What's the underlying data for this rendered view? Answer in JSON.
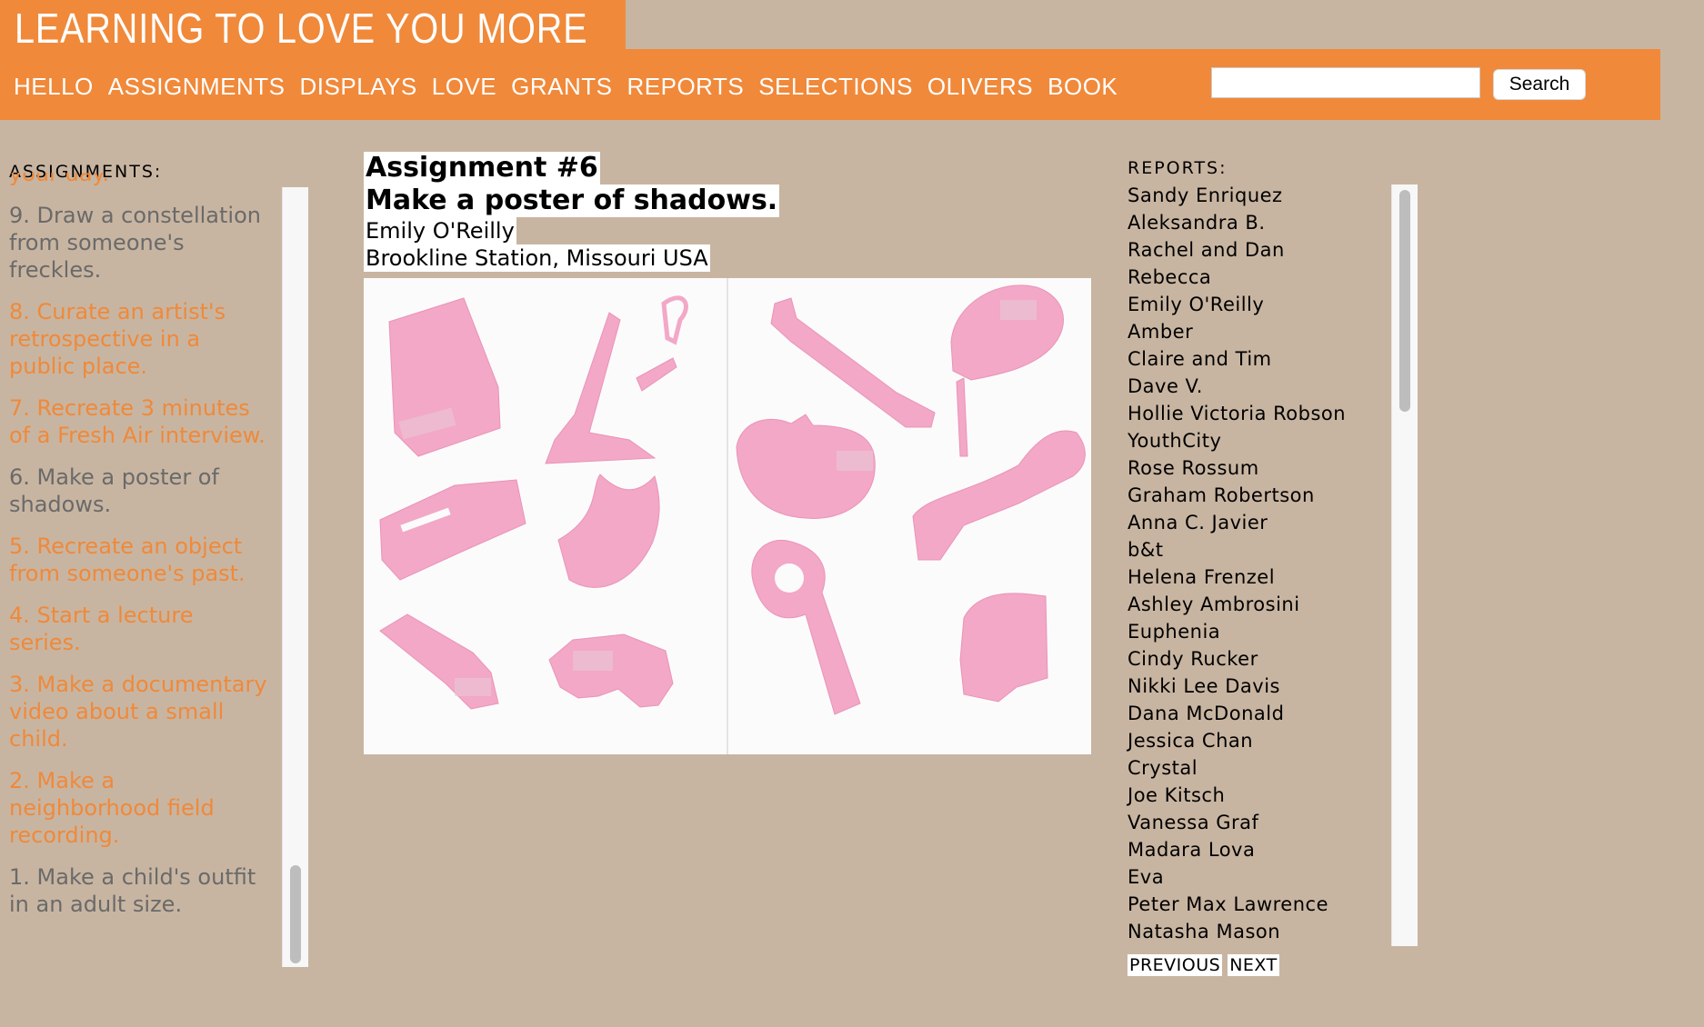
{
  "site": {
    "logo_text": "LEARNING TO LOVE YOU MORE"
  },
  "nav": {
    "items": [
      "HELLO",
      "ASSIGNMENTS",
      "DISPLAYS",
      "LOVE",
      "GRANTS",
      "REPORTS",
      "SELECTIONS",
      "OLIVERS",
      "BOOK"
    ],
    "search_value": "",
    "search_button": "Search"
  },
  "sidebar": {
    "heading": "ASSIGNMENTS:",
    "items": [
      {
        "text": "your day.",
        "color": "orange"
      },
      {
        "text": "9. Draw a constellation from someone's freckles.",
        "color": "gray"
      },
      {
        "text": "8. Curate an artist's retrospective in a public place.",
        "color": "orange"
      },
      {
        "text": "7. Recreate 3 minutes of a Fresh Air interview.",
        "color": "orange"
      },
      {
        "text": "6. Make a poster of shadows.",
        "color": "gray"
      },
      {
        "text": "5. Recreate an object from someone's past.",
        "color": "orange"
      },
      {
        "text": "4. Start a lecture series.",
        "color": "orange"
      },
      {
        "text": "3. Make a documentary video about a small child.",
        "color": "orange"
      },
      {
        "text": "2. Make a neighborhood field recording.",
        "color": "orange"
      },
      {
        "text": "1. Make a child's outfit in an adult size.",
        "color": "gray"
      }
    ],
    "scroll_position": 0.95
  },
  "main": {
    "assignment_number": "Assignment #6",
    "assignment_title": "Make a poster of shadows.",
    "author": "Emily O'Reilly",
    "location": "Brookline Station, Missouri USA",
    "image_subject": "pink paper cut-out shadow shapes on white poster"
  },
  "reports": {
    "heading": "REPORTS:",
    "items": [
      "Sandy Enriquez",
      "Aleksandra B.",
      "Rachel and Dan",
      "Rebecca",
      "Emily O'Reilly",
      "Amber",
      "Claire and Tim",
      "Dave V.",
      "Hollie Victoria Robson",
      "YouthCity",
      "Rose Rossum",
      "Graham Robertson",
      "Anna C. Javier",
      "b&t",
      "Helena Frenzel",
      "Ashley Ambrosini",
      "Euphenia",
      "Cindy Rucker",
      "Nikki Lee Davis",
      "Dana McDonald",
      "Jessica Chan",
      "Crystal",
      "Joe Kitsch",
      "Vanessa Graf",
      "Madara Lova",
      "Eva",
      "Peter Max Lawrence",
      "Natasha Mason"
    ],
    "previous_label": "PREVIOUS",
    "next_label": "NEXT",
    "scroll_position": 0.0
  },
  "colors": {
    "background": "#c8b5a1",
    "accent_orange": "#f0893a",
    "link_orange": "#f0893a",
    "visited_gray": "#6a6a6a",
    "shadow_pink": "#f2a8c6"
  }
}
